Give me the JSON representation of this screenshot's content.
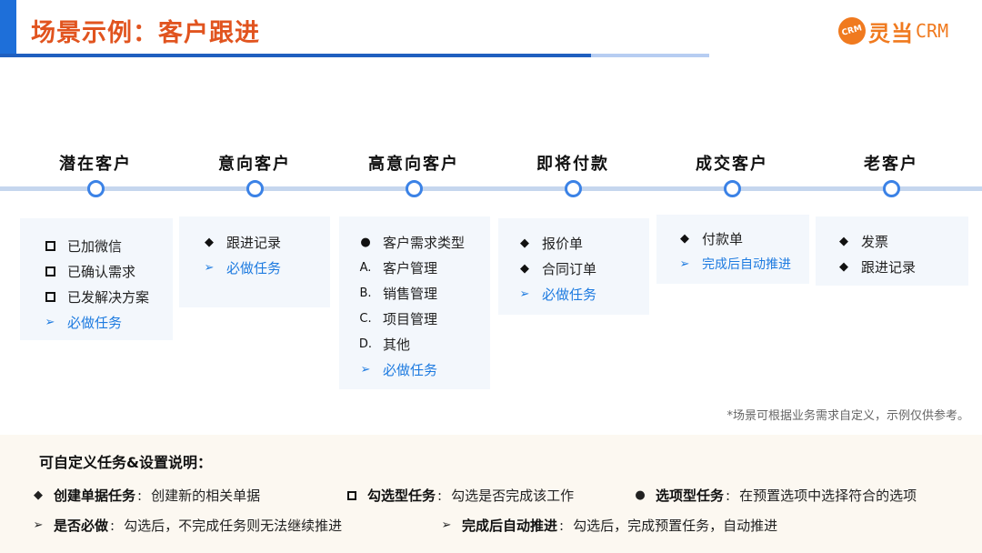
{
  "header": {
    "title": "场景示例：客户跟进",
    "logo_badge": "CRM",
    "logo_name": "灵当",
    "logo_crm": "CRM"
  },
  "stages": [
    {
      "title": "潜在客户",
      "items": [
        {
          "marker": "square",
          "text": "已加微信"
        },
        {
          "marker": "square",
          "text": "已确认需求"
        },
        {
          "marker": "square",
          "text": "已发解决方案"
        },
        {
          "marker": "arrow",
          "text": "必做任务",
          "task": true
        }
      ]
    },
    {
      "title": "意向客户",
      "items": [
        {
          "marker": "diamond",
          "text": "跟进记录"
        },
        {
          "marker": "arrow",
          "text": "必做任务",
          "task": true
        }
      ]
    },
    {
      "title": "高意向客户",
      "items": [
        {
          "marker": "dot",
          "text": "客户需求类型"
        },
        {
          "marker": "letter",
          "letter": "A.",
          "text": "客户管理"
        },
        {
          "marker": "letter",
          "letter": "B.",
          "text": "销售管理"
        },
        {
          "marker": "letter",
          "letter": "C.",
          "text": "项目管理"
        },
        {
          "marker": "letter",
          "letter": "D.",
          "text": "其他"
        },
        {
          "marker": "arrow",
          "text": "必做任务",
          "task": true
        }
      ]
    },
    {
      "title": "即将付款",
      "items": [
        {
          "marker": "diamond",
          "text": "报价单"
        },
        {
          "marker": "diamond",
          "text": "合同订单"
        },
        {
          "marker": "arrow",
          "text": "必做任务",
          "task": true
        }
      ]
    },
    {
      "title": "成交客户",
      "items": [
        {
          "marker": "diamond",
          "text": "付款单"
        },
        {
          "marker": "arrow",
          "text": "完成后自动推进",
          "task": true
        }
      ]
    },
    {
      "title": "老客户",
      "items": [
        {
          "marker": "diamond",
          "text": "发票"
        },
        {
          "marker": "diamond",
          "text": "跟进记录"
        }
      ]
    }
  ],
  "note": "*场景可根据业务需求自定义，示例仅供参考。",
  "legend": {
    "title": "可自定义任务&设置说明：",
    "create": {
      "term": "创建单据任务",
      "colon": ":",
      "desc": "创建新的相关单据"
    },
    "check": {
      "term": "勾选型任务",
      "colon": ":",
      "desc": "勾选是否完成该工作"
    },
    "option": {
      "term": "选项型任务",
      "colon": ":",
      "desc": "在预置选项中选择符合的选项"
    },
    "required": {
      "term": "是否必做",
      "colon": ":",
      "desc": "勾选后，不完成任务则无法继续推进"
    },
    "auto": {
      "term": "完成后自动推进",
      "colon": ":",
      "desc": "勾选后，完成预置任务，自动推进"
    }
  },
  "colors": {
    "accent_blue": "#1e6fd9",
    "title_orange": "#e1541f",
    "task_blue": "#1e7be0",
    "logo_orange": "#f07a1f"
  }
}
